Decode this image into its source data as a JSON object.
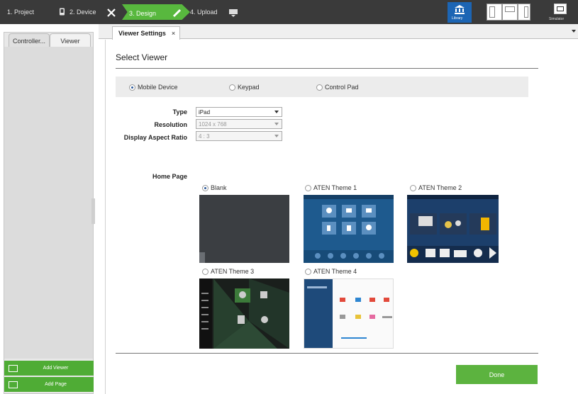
{
  "steps": [
    {
      "label": "1. Project"
    },
    {
      "label": "2. Device"
    },
    {
      "label": "3. Design"
    },
    {
      "label": "4. Upload"
    }
  ],
  "top_right": {
    "library_label": "Library",
    "simulator_label": "Simulator"
  },
  "sidebar": {
    "tabs": [
      {
        "label": "Controller..."
      },
      {
        "label": "Viewer"
      }
    ],
    "buttons": [
      {
        "label": "Add Viewer"
      },
      {
        "label": "Add Page"
      }
    ]
  },
  "tab": {
    "label": "Viewer Settings",
    "close": "×"
  },
  "main": {
    "title": "Select Viewer",
    "viewer_types": [
      {
        "label": "Mobile Device",
        "selected": true
      },
      {
        "label": "Keypad",
        "selected": false
      },
      {
        "label": "Control Pad",
        "selected": false
      }
    ],
    "fields": [
      {
        "label": "Type",
        "value": "iPad",
        "disabled": false
      },
      {
        "label": "Resolution",
        "value": "1024 x 768",
        "disabled": true
      },
      {
        "label": "Display Aspect Ratio",
        "value": "4 : 3",
        "disabled": true
      }
    ],
    "home_page_label": "Home Page",
    "themes": [
      {
        "label": "Blank",
        "selected": true
      },
      {
        "label": "ATEN Theme 1",
        "selected": false
      },
      {
        "label": "ATEN Theme 2",
        "selected": false
      },
      {
        "label": "ATEN Theme 3",
        "selected": false
      },
      {
        "label": "ATEN Theme 4",
        "selected": false
      }
    ],
    "done_label": "Done"
  },
  "colors": {
    "accent_green": "#58b83e",
    "library_blue": "#1c65b4",
    "topbar": "#3a3a3a"
  }
}
